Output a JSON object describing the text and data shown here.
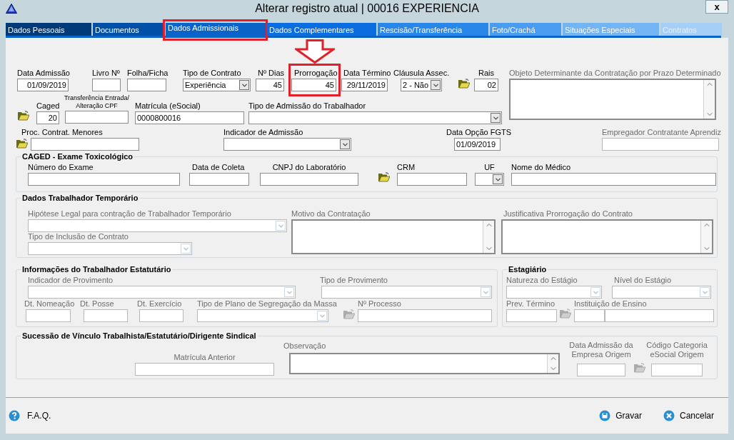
{
  "window": {
    "title": "Alterar registro atual | 00016 EXPERIENCIA",
    "close": "x"
  },
  "tabs": [
    {
      "label": "Dados Pessoais",
      "selected": false,
      "highlighted": false
    },
    {
      "label": "Documentos",
      "selected": false,
      "highlighted": false
    },
    {
      "label": "Dados Admissionais",
      "selected": true,
      "highlighted": true
    },
    {
      "label": "Dados Complementares",
      "selected": false,
      "highlighted": false
    },
    {
      "label": "Rescisão/Transferência",
      "selected": false,
      "highlighted": false
    },
    {
      "label": "Foto/Crachá",
      "selected": false,
      "highlighted": false
    },
    {
      "label": "Situações Especiais",
      "selected": false,
      "highlighted": false
    },
    {
      "label": "Contratos",
      "selected": false,
      "highlighted": false
    }
  ],
  "form": [
    {
      "kind": "rows",
      "rows": [
        {
          "fields": [
            {
              "kind": "text",
              "label": "Data Admissão",
              "value": "01/09/2019",
              "disabled": false
            },
            {
              "kind": "text",
              "label": "Livro Nº",
              "disabled": false
            },
            {
              "kind": "text",
              "label": "Folha/Ficha",
              "disabled": false
            },
            {
              "kind": "select",
              "label": "Tipo de Contrato",
              "value": "Experiência",
              "disabled": false
            },
            {
              "kind": "text",
              "label": "Nº Dias",
              "value": "45",
              "disabled": false
            },
            {
              "kind": "text",
              "label": "Prorrogação",
              "value": "45",
              "disabled": false,
              "highlighted": true,
              "pointer": true
            },
            {
              "kind": "text",
              "label": "Data Término",
              "value": "29/11/2019",
              "disabled": false
            },
            {
              "kind": "select",
              "label": "Cláusula Assec.",
              "value": "2 - Não",
              "disabled": false
            },
            {
              "kind": "lookup",
              "disabled": false
            },
            {
              "kind": "text",
              "label": "Rais",
              "value": "02",
              "disabled": false
            },
            {
              "kind": "memo",
              "label": "Objeto Determinante da Contratação por Prazo Determinado",
              "disabled": true
            }
          ]
        },
        {
          "fields": [
            {
              "kind": "lookup",
              "disabled": false
            },
            {
              "kind": "text",
              "label": "Caged",
              "value": "20",
              "disabled": false
            },
            {
              "kind": "text",
              "label": "Transferência Entrada/ Alteração CPF",
              "disabled": false
            },
            {
              "kind": "text",
              "label": "Matrícula (eSocial)",
              "value": "0000800016",
              "disabled": false
            },
            {
              "kind": "select",
              "label": "Tipo de Admissão do Trabalhador",
              "disabled": false
            }
          ]
        },
        {
          "fields": [
            {
              "kind": "lookup",
              "disabled": false
            },
            {
              "kind": "text",
              "label": "Proc. Contrat. Menores",
              "disabled": false
            },
            {
              "kind": "select",
              "label": "Indicador de Admissão",
              "disabled": false
            },
            {
              "kind": "text",
              "label": "Data Opção FGTS",
              "value": "01/09/2019",
              "disabled": false
            },
            {
              "kind": "text",
              "label": "Empregador Contratante Aprendiz",
              "disabled": true
            }
          ]
        }
      ]
    },
    {
      "kind": "group",
      "title": "CAGED - Exame Toxicológico",
      "rows": [
        {
          "fields": [
            {
              "kind": "text",
              "label": "Número do Exame",
              "disabled": false
            },
            {
              "kind": "text",
              "label": "Data de Coleta",
              "disabled": false
            },
            {
              "kind": "text",
              "label": "CNPJ do Laboratório",
              "disabled": false
            },
            {
              "kind": "lookup",
              "disabled": false
            },
            {
              "kind": "text",
              "label": "CRM",
              "disabled": false
            },
            {
              "kind": "select",
              "label": "UF",
              "disabled": false
            },
            {
              "kind": "text",
              "label": "Nome do Médico",
              "disabled": false
            }
          ]
        }
      ]
    },
    {
      "kind": "group",
      "title": "Dados Trabalhador Temporário",
      "rows": [
        {
          "fields": [
            {
              "kind": "select",
              "label": "Hipótese Legal para contração de Trabalhador Temporário",
              "disabled": true
            },
            {
              "kind": "memo",
              "label": "Motivo da Contratação",
              "disabled": true
            },
            {
              "kind": "memo",
              "label": "Justificativa Prorrogação do Contrato",
              "disabled": true
            }
          ]
        },
        {
          "fields": [
            {
              "kind": "select",
              "label": "Tipo de Inclusão de Contrato",
              "disabled": true
            }
          ]
        }
      ]
    },
    {
      "kind": "pair",
      "groups": [
        {
          "title": "Informações do Trabalhador Estatutário",
          "rows": [
            {
              "fields": [
                {
                  "kind": "select",
                  "label": "Indicador de Provimento",
                  "disabled": true
                },
                {
                  "kind": "select",
                  "label": "Tipo de Provimento",
                  "disabled": true
                }
              ]
            },
            {
              "fields": [
                {
                  "kind": "text",
                  "label": "Dt. Nomeação",
                  "disabled": true
                },
                {
                  "kind": "text",
                  "label": "Dt. Posse",
                  "disabled": true
                },
                {
                  "kind": "text",
                  "label": "Dt. Exercício",
                  "disabled": true
                },
                {
                  "kind": "select",
                  "label": "Tipo de Plano de Segregação da Massa",
                  "disabled": true
                },
                {
                  "kind": "lookup",
                  "disabled": true
                },
                {
                  "kind": "text",
                  "label": "Nº Processo",
                  "disabled": true
                }
              ]
            }
          ]
        },
        {
          "title": "Estagiário",
          "rows": [
            {
              "fields": [
                {
                  "kind": "select",
                  "label": "Natureza do Estágio",
                  "disabled": true
                },
                {
                  "kind": "select",
                  "label": "Nível do Estágio",
                  "disabled": true
                }
              ]
            },
            {
              "fields": [
                {
                  "kind": "text",
                  "label": "Prev. Término",
                  "disabled": true
                },
                {
                  "kind": "lookup",
                  "disabled": true
                },
                {
                  "kind": "text",
                  "label": "Instituição de Ensino",
                  "disabled": true
                },
                {
                  "kind": "text",
                  "disabled": true
                }
              ]
            }
          ]
        }
      ]
    },
    {
      "kind": "group",
      "title": "Sucessão de Vínculo Trabalhista/Estatutário/Dirigente Sindical",
      "rows": [
        {
          "fields": [
            {
              "kind": "text",
              "label": "Matrícula Anterior",
              "disabled": true
            },
            {
              "kind": "memo",
              "label": "Observação",
              "disabled": true
            },
            {
              "kind": "text",
              "label": "Data Admissão da Empresa Origem",
              "disabled": true
            },
            {
              "kind": "lookup",
              "disabled": true
            },
            {
              "kind": "text",
              "label": "Código Categoria eSocial Origem",
              "disabled": true
            }
          ]
        }
      ]
    }
  ],
  "footer": {
    "help_link": "F.A.Q.",
    "buttons": [
      {
        "kind": "save",
        "label": "Gravar"
      },
      {
        "kind": "cancel",
        "label": "Cancelar"
      }
    ]
  }
}
